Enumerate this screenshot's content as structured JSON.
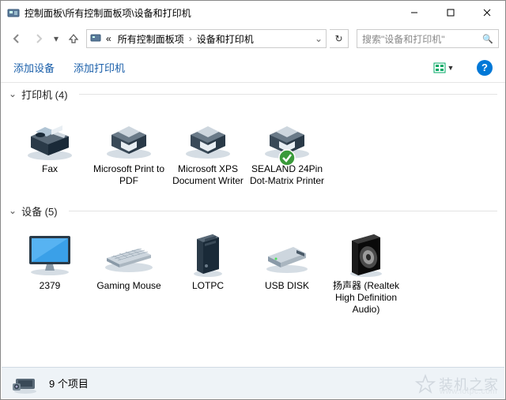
{
  "window_title": "控制面板\\所有控制面板项\\设备和打印机",
  "breadcrumb": {
    "prefix": "«",
    "parts": [
      "所有控制面板项",
      "设备和打印机"
    ]
  },
  "nav": {
    "down_arrow": "▾"
  },
  "refresh_glyph": "↻",
  "search": {
    "icon": "🔍",
    "placeholder": "搜索\"设备和打印机\""
  },
  "toolbar": {
    "add_device": "添加设备",
    "add_printer": "添加打印机",
    "help": "?"
  },
  "groups": [
    {
      "label": "打印机 (4)",
      "kind": "printers",
      "items": [
        {
          "name": "Fax",
          "icon": "fax",
          "default": false
        },
        {
          "name": "Microsoft Print to PDF",
          "icon": "printer",
          "default": false
        },
        {
          "name": "Microsoft XPS Document Writer",
          "icon": "printer",
          "default": false
        },
        {
          "name": "SEALAND 24Pin Dot-Matrix Printer",
          "icon": "printer",
          "default": true
        }
      ]
    },
    {
      "label": "设备 (5)",
      "kind": "devices",
      "items": [
        {
          "name": "2379",
          "icon": "monitor"
        },
        {
          "name": "Gaming Mouse",
          "icon": "keyboard"
        },
        {
          "name": "LOTPC",
          "icon": "tower"
        },
        {
          "name": "USB DISK",
          "icon": "usbdisk"
        },
        {
          "name": "扬声器 (Realtek High Definition Audio)",
          "icon": "speaker"
        }
      ]
    }
  ],
  "statusbar": {
    "count_text": "9 个项目"
  },
  "watermark": {
    "text": "装机之家",
    "url": "www.lotpc.com"
  }
}
